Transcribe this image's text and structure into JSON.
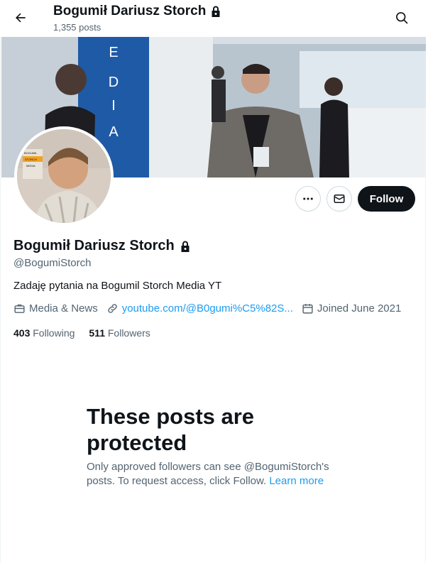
{
  "header": {
    "name": "Bogumił Dariusz Storch",
    "posts": "1,355 posts"
  },
  "banner": {
    "sign_letters": [
      "E",
      "D",
      "I",
      "A"
    ],
    "side_text": "EDIA"
  },
  "profile": {
    "name": "Bogumił Dariusz Storch",
    "handle": "@BogumiStorch",
    "bio": "Zadaję pytania na Bogumil Storch Media YT",
    "category": "Media & News",
    "website": "youtube.com/@B0gumi%C5%82S...",
    "joined": "Joined June 2021",
    "following_count": "403",
    "following_label": "Following",
    "followers_count": "511",
    "followers_label": "Followers"
  },
  "actions": {
    "follow_label": "Follow"
  },
  "avatar_badge": [
    "BOGUMIL",
    "STORCH",
    "MEDIA"
  ],
  "protected": {
    "title": "These posts are protected",
    "text": "Only approved followers can see @BogumiStorch's posts. To request access, click Follow.",
    "link": "Learn more"
  },
  "icons": {
    "back": "arrow-left-icon",
    "lock": "lock-icon",
    "search": "search-icon",
    "more": "more-horizontal-icon",
    "message": "envelope-icon",
    "category": "briefcase-icon",
    "link": "link-icon",
    "calendar": "calendar-icon"
  },
  "colors": {
    "text_primary": "#0f1419",
    "text_secondary": "#536471",
    "link": "#1d9bf0",
    "button_dark": "#0f1419",
    "border": "#cfd9de"
  }
}
